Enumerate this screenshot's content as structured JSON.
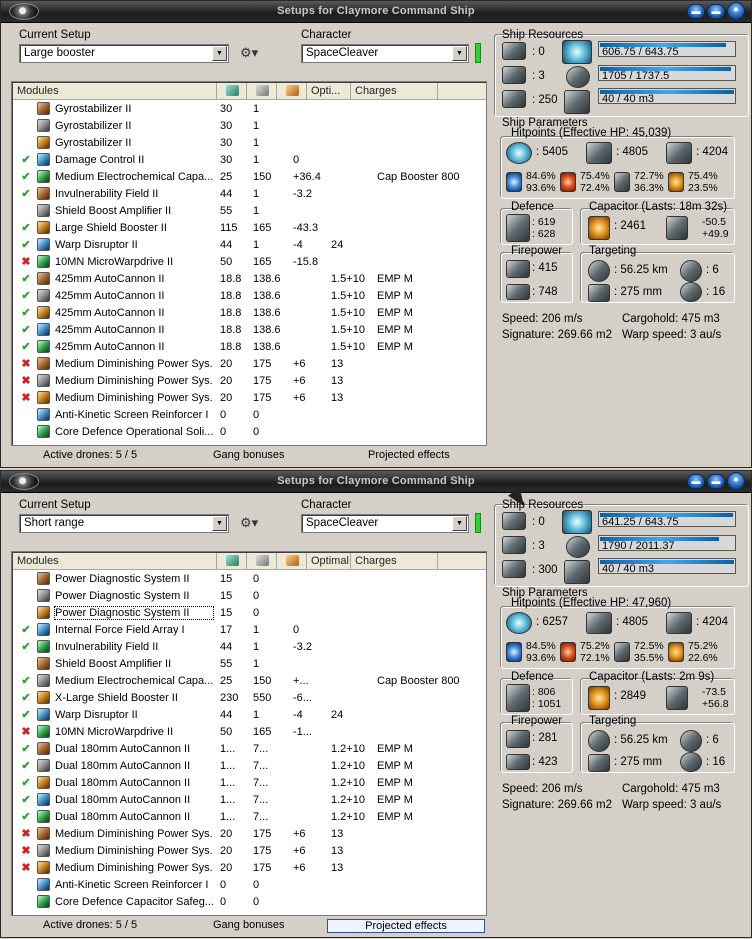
{
  "windows": [
    {
      "title": "Setups for Claymore Command Ship",
      "current_setup_label": "Current Setup",
      "current_setup_value": "Large booster",
      "character_label": "Character",
      "character_value": "SpaceCleaver",
      "columns": [
        "Modules",
        "",
        "",
        "",
        "Opti...",
        "Charges"
      ],
      "modules": [
        {
          "status": "",
          "name": "Gyrostabilizer II",
          "cpu": "30",
          "pg": "1",
          "cap": "",
          "opt": "",
          "charge": ""
        },
        {
          "status": "",
          "name": "Gyrostabilizer II",
          "cpu": "30",
          "pg": "1",
          "cap": "",
          "opt": "",
          "charge": ""
        },
        {
          "status": "",
          "name": "Gyrostabilizer II",
          "cpu": "30",
          "pg": "1",
          "cap": "",
          "opt": "",
          "charge": ""
        },
        {
          "status": "on",
          "name": "Damage Control II",
          "cpu": "30",
          "pg": "1",
          "cap": "0",
          "opt": "",
          "charge": ""
        },
        {
          "status": "on",
          "name": "Medium Electrochemical Capa...",
          "cpu": "25",
          "pg": "150",
          "cap": "+36.4",
          "opt": "",
          "charge": "Cap Booster 800"
        },
        {
          "status": "on",
          "name": "Invulnerability Field II",
          "cpu": "44",
          "pg": "1",
          "cap": "-3.2",
          "opt": "",
          "charge": ""
        },
        {
          "status": "",
          "name": "Shield Boost Amplifier II",
          "cpu": "55",
          "pg": "1",
          "cap": "",
          "opt": "",
          "charge": ""
        },
        {
          "status": "on",
          "name": "Large Shield Booster II",
          "cpu": "115",
          "pg": "165",
          "cap": "-43.3",
          "opt": "",
          "charge": ""
        },
        {
          "status": "on",
          "name": "Warp Disruptor II",
          "cpu": "44",
          "pg": "1",
          "cap": "-4",
          "opt": "24",
          "charge": ""
        },
        {
          "status": "off",
          "name": "10MN MicroWarpdrive II",
          "cpu": "50",
          "pg": "165",
          "cap": "-15.8",
          "opt": "",
          "charge": ""
        },
        {
          "status": "on",
          "name": "425mm AutoCannon II",
          "cpu": "18.8",
          "pg": "138.6",
          "cap": "",
          "opt": "1.5+10",
          "charge": "EMP M"
        },
        {
          "status": "on",
          "name": "425mm AutoCannon II",
          "cpu": "18.8",
          "pg": "138.6",
          "cap": "",
          "opt": "1.5+10",
          "charge": "EMP M"
        },
        {
          "status": "on",
          "name": "425mm AutoCannon II",
          "cpu": "18.8",
          "pg": "138.6",
          "cap": "",
          "opt": "1.5+10",
          "charge": "EMP M"
        },
        {
          "status": "on",
          "name": "425mm AutoCannon II",
          "cpu": "18.8",
          "pg": "138.6",
          "cap": "",
          "opt": "1.5+10",
          "charge": "EMP M"
        },
        {
          "status": "on",
          "name": "425mm AutoCannon II",
          "cpu": "18.8",
          "pg": "138.6",
          "cap": "",
          "opt": "1.5+10",
          "charge": "EMP M"
        },
        {
          "status": "off",
          "name": "Medium Diminishing Power Sys...",
          "cpu": "20",
          "pg": "175",
          "cap": "+6",
          "opt": "13",
          "charge": ""
        },
        {
          "status": "off",
          "name": "Medium Diminishing Power Sys...",
          "cpu": "20",
          "pg": "175",
          "cap": "+6",
          "opt": "13",
          "charge": ""
        },
        {
          "status": "off",
          "name": "Medium Diminishing Power Sys...",
          "cpu": "20",
          "pg": "175",
          "cap": "+6",
          "opt": "13",
          "charge": ""
        },
        {
          "status": "",
          "name": "Anti-Kinetic Screen Reinforcer I",
          "cpu": "0",
          "pg": "0",
          "cap": "",
          "opt": "",
          "charge": ""
        },
        {
          "status": "",
          "name": "Core Defence Operational Soli...",
          "cpu": "0",
          "pg": "0",
          "cap": "",
          "opt": "",
          "charge": ""
        }
      ],
      "footer": {
        "drones": "Active drones: 5 / 5",
        "gang": "Gang bonuses",
        "projected": "Projected effects"
      },
      "res": {
        "title": "Ship Resources",
        "turrets": ": 0",
        "launchers": ": 3",
        "drone_bw": ": 250",
        "cpu": "606.75 / 643.75",
        "cpu_frac": 0.943,
        "pg": "1705 / 1737.5",
        "pg_frac": 0.981,
        "drone_bay": "40 / 40 m3",
        "drone_frac": 1.0
      },
      "params": {
        "title": "Ship Parameters",
        "hp_title": "Hitpoints (Effective HP: 45,039)",
        "shield_hp": ": 5405",
        "armor_hp": ": 4805",
        "hull_hp": ": 4204",
        "res_shield_em": "84.6%",
        "res_shield_th": "93.6%",
        "res_armor_em": "75.4%",
        "res_armor_th": "72.4%",
        "res_kin_a": "72.7%",
        "res_kin_b": "36.3%",
        "res_exp_a": "75.4%",
        "res_exp_b": "23.5%",
        "def_title": "Defence",
        "def_a": ": 619",
        "def_b": ": 628",
        "cap_title": "Capacitor (Lasts: 18m 32s)",
        "cap_amt": ": 2461",
        "cap_a": "-50.5",
        "cap_b": "+49.9",
        "fp_title": "Firepower",
        "fp_a": ": 415",
        "fp_b": ": 748",
        "tg_title": "Targeting",
        "tg_range": ": 56.25 km",
        "tg_targets": ": 6",
        "tg_res": ": 275 mm",
        "tg_sens": ": 16",
        "speed": "Speed: 206 m/s",
        "cargo": "Cargohold: 475 m3",
        "sig": "Signature: 269.66 m2",
        "warp": "Warp speed: 3 au/s"
      }
    },
    {
      "title": "Setups for Claymore Command Ship",
      "current_setup_label": "Current Setup",
      "current_setup_value": "Short range",
      "character_label": "Character",
      "character_value": "SpaceCleaver",
      "columns": [
        "Modules",
        "",
        "",
        "",
        "Optimal",
        "Charges"
      ],
      "modules": [
        {
          "status": "",
          "name": "Power Diagnostic System II",
          "cpu": "15",
          "pg": "0",
          "cap": "",
          "opt": "",
          "charge": ""
        },
        {
          "status": "",
          "name": "Power Diagnostic System II",
          "cpu": "15",
          "pg": "0",
          "cap": "",
          "opt": "",
          "charge": ""
        },
        {
          "status": "",
          "name": "Power Diagnostic System II",
          "cpu": "15",
          "pg": "0",
          "cap": "",
          "opt": "",
          "charge": "",
          "selected": true
        },
        {
          "status": "on",
          "name": "Internal Force Field Array I",
          "cpu": "17",
          "pg": "1",
          "cap": "0",
          "opt": "",
          "charge": ""
        },
        {
          "status": "on",
          "name": "Invulnerability Field II",
          "cpu": "44",
          "pg": "1",
          "cap": "-3.2",
          "opt": "",
          "charge": ""
        },
        {
          "status": "",
          "name": "Shield Boost Amplifier II",
          "cpu": "55",
          "pg": "1",
          "cap": "",
          "opt": "",
          "charge": ""
        },
        {
          "status": "on",
          "name": "Medium Electrochemical Capa...",
          "cpu": "25",
          "pg": "150",
          "cap": "+...",
          "opt": "",
          "charge": "Cap Booster 800"
        },
        {
          "status": "on",
          "name": "X-Large Shield Booster II",
          "cpu": "230",
          "pg": "550",
          "cap": "-6...",
          "opt": "",
          "charge": ""
        },
        {
          "status": "on",
          "name": "Warp Disruptor II",
          "cpu": "44",
          "pg": "1",
          "cap": "-4",
          "opt": "24",
          "charge": ""
        },
        {
          "status": "off",
          "name": "10MN MicroWarpdrive II",
          "cpu": "50",
          "pg": "165",
          "cap": "-1...",
          "opt": "",
          "charge": ""
        },
        {
          "status": "on",
          "name": "Dual 180mm AutoCannon II",
          "cpu": "1...",
          "pg": "7...",
          "cap": "",
          "opt": "1.2+10",
          "charge": "EMP M"
        },
        {
          "status": "on",
          "name": "Dual 180mm AutoCannon II",
          "cpu": "1...",
          "pg": "7...",
          "cap": "",
          "opt": "1.2+10",
          "charge": "EMP M"
        },
        {
          "status": "on",
          "name": "Dual 180mm AutoCannon II",
          "cpu": "1...",
          "pg": "7...",
          "cap": "",
          "opt": "1.2+10",
          "charge": "EMP M"
        },
        {
          "status": "on",
          "name": "Dual 180mm AutoCannon II",
          "cpu": "1...",
          "pg": "7...",
          "cap": "",
          "opt": "1.2+10",
          "charge": "EMP M"
        },
        {
          "status": "on",
          "name": "Dual 180mm AutoCannon II",
          "cpu": "1...",
          "pg": "7...",
          "cap": "",
          "opt": "1.2+10",
          "charge": "EMP M"
        },
        {
          "status": "off",
          "name": "Medium Diminishing Power Sys...",
          "cpu": "20",
          "pg": "175",
          "cap": "+6",
          "opt": "13",
          "charge": ""
        },
        {
          "status": "off",
          "name": "Medium Diminishing Power Sys...",
          "cpu": "20",
          "pg": "175",
          "cap": "+6",
          "opt": "13",
          "charge": ""
        },
        {
          "status": "off",
          "name": "Medium Diminishing Power Sys...",
          "cpu": "20",
          "pg": "175",
          "cap": "+6",
          "opt": "13",
          "charge": ""
        },
        {
          "status": "",
          "name": "Anti-Kinetic Screen Reinforcer I",
          "cpu": "0",
          "pg": "0",
          "cap": "",
          "opt": "",
          "charge": ""
        },
        {
          "status": "",
          "name": "Core Defence Capacitor Safeg...",
          "cpu": "0",
          "pg": "0",
          "cap": "",
          "opt": "",
          "charge": ""
        }
      ],
      "footer": {
        "drones": "Active drones: 5 / 5",
        "gang": "Gang bonuses",
        "projected": "Projected effects"
      },
      "res": {
        "title": "Ship Resources",
        "turrets": ": 0",
        "launchers": ": 3",
        "drone_bw": ": 300",
        "cpu": "641.25 / 643.75",
        "cpu_frac": 0.996,
        "pg": "1790 / 2011.37",
        "pg_frac": 0.89,
        "drone_bay": "40 / 40 m3",
        "drone_frac": 1.0
      },
      "params": {
        "title": "Ship Parameters",
        "hp_title": "Hitpoints (Effective HP: 47,960)",
        "shield_hp": ": 6257",
        "armor_hp": ": 4805",
        "hull_hp": ": 4204",
        "res_shield_em": "84.5%",
        "res_shield_th": "93.6%",
        "res_armor_em": "75.2%",
        "res_armor_th": "72.1%",
        "res_kin_a": "72.5%",
        "res_kin_b": "35.5%",
        "res_exp_a": "75.2%",
        "res_exp_b": "22.6%",
        "def_title": "Defence",
        "def_a": ": 806",
        "def_b": ": 1051",
        "cap_title": "Capacitor (Lasts: 2m 9s)",
        "cap_amt": ": 2849",
        "cap_a": "-73.5",
        "cap_b": "+56.8",
        "fp_title": "Firepower",
        "fp_a": ": 281",
        "fp_b": ": 423",
        "tg_title": "Targeting",
        "tg_range": ": 56.25 km",
        "tg_targets": ": 6",
        "tg_res": ": 275 mm",
        "tg_sens": ": 16",
        "speed": "Speed: 206 m/s",
        "cargo": "Cargohold: 475 m3",
        "sig": "Signature: 269.66 m2",
        "warp": "Warp speed: 3 au/s"
      }
    }
  ],
  "status_symbols": {
    "on": "✔",
    "off": "✖"
  },
  "colors": {
    "active_check": "#2aa52a",
    "offline_x": "#cc2222",
    "status_ok": "#2fd22f",
    "bar_fill": "#3ea8ee"
  }
}
